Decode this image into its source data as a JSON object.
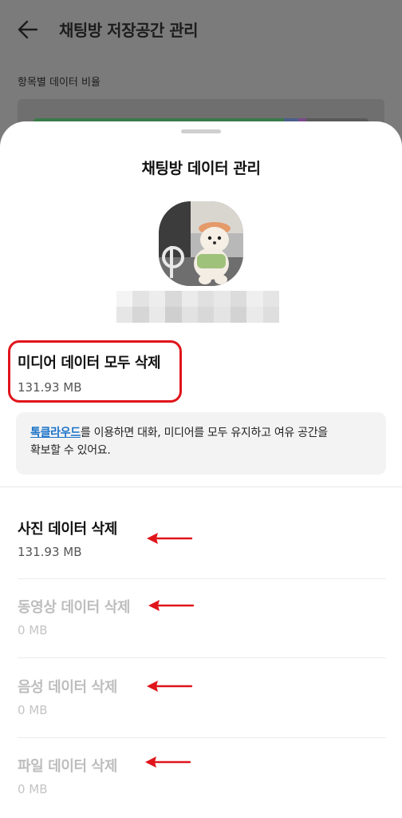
{
  "background": {
    "title": "채팅방 저장공간 관리",
    "subtitle": "항목별 데이터 비율"
  },
  "sheet": {
    "title": "채팅방 데이터 관리",
    "delete_all": {
      "title": "미디어 데이터 모두 삭제",
      "size": "131.93 MB"
    },
    "info": {
      "link_text": "톡클라우드",
      "text_line1": "를 이용하면 대화, 미디어를 모두 유지하고 여유 공간을",
      "text_line2": "확보할 수 있어요."
    },
    "items": [
      {
        "title": "사진 데이터 삭제",
        "size": "131.93 MB",
        "enabled": true
      },
      {
        "title": "동영상 데이터 삭제",
        "size": "0 MB",
        "enabled": false
      },
      {
        "title": "음성 데이터 삭제",
        "size": "0 MB",
        "enabled": false
      },
      {
        "title": "파일 데이터 삭제",
        "size": "0 MB",
        "enabled": false
      }
    ]
  },
  "colors": {
    "highlight": "#e0141b",
    "link": "#1a73c9",
    "annotation_arrow": "#e0141b"
  },
  "icons": {
    "back": "arrow-left-icon"
  }
}
